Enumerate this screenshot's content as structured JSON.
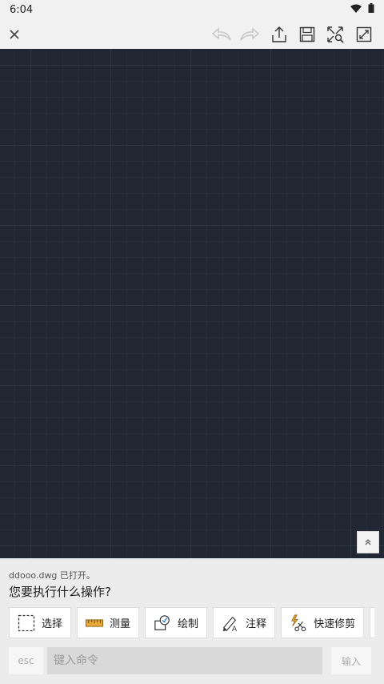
{
  "status": {
    "time": "6:04",
    "wifi_icon": "wifi-icon",
    "battery_icon": "battery-icon"
  },
  "toolbar": {
    "close_icon": "close-icon",
    "undo_icon": "undo-icon",
    "redo_icon": "redo-icon",
    "share_icon": "share-icon",
    "save_icon": "save-icon",
    "zoom_extents_icon": "zoom-extents-icon",
    "fullscreen_icon": "fullscreen-icon"
  },
  "panel": {
    "file_status": "ddooo.dwg 已打开。",
    "prompt": "您要执行什么操作?",
    "tools": [
      {
        "label": "选择",
        "icon": "select-icon"
      },
      {
        "label": "测量",
        "icon": "ruler-icon"
      },
      {
        "label": "绘制",
        "icon": "draw-icon"
      },
      {
        "label": "注释",
        "icon": "annotate-icon"
      },
      {
        "label": "快速修剪",
        "icon": "quick-trim-icon"
      }
    ],
    "esc_label": "esc",
    "command_placeholder": "键入命令",
    "enter_label": "输入"
  },
  "colors": {
    "canvas_bg": "#212732",
    "panel_bg": "#ececec"
  }
}
